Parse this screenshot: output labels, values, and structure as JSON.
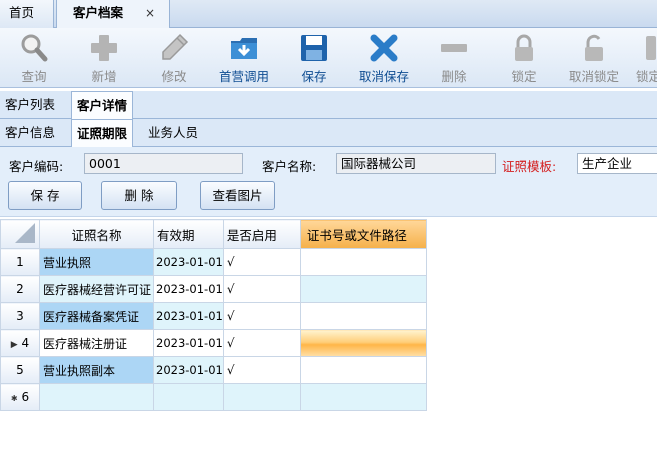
{
  "top_tabs": {
    "home": "首页",
    "active": "客户档案",
    "close": "×"
  },
  "toolbar": {
    "query": "查询",
    "add": "新增",
    "edit": "修改",
    "import": "首营调用",
    "save": "保存",
    "cancel_save": "取消保存",
    "delete": "删除",
    "lock": "锁定",
    "unlock": "取消锁定",
    "lock2": "锁定"
  },
  "tabs_row1": {
    "list": "客户列表",
    "detail": "客户详情"
  },
  "tabs_row2": {
    "info": "客户信息",
    "license": "证照期限",
    "sales": "业务人员"
  },
  "form": {
    "code_label": "客户编码:",
    "code_value": "0001",
    "name_label": "客户名称:",
    "name_value": "国际器械公司",
    "template_label": "证照模板:",
    "template_value": "生产企业",
    "save_btn": "保  存",
    "delete_btn": "删  除",
    "view_btn": "查看图片"
  },
  "grid": {
    "columns": [
      "证照名称",
      "有效期",
      "是否启用",
      "证书号或文件路径"
    ],
    "rows": [
      {
        "num": "1",
        "name": "营业执照",
        "date": "2023-01-01",
        "enabled": "√",
        "path": ""
      },
      {
        "num": "2",
        "name": "医疗器械经营许可证",
        "date": "2023-01-01",
        "enabled": "√",
        "path": ""
      },
      {
        "num": "3",
        "name": "医疗器械备案凭证",
        "date": "2023-01-01",
        "enabled": "√",
        "path": ""
      },
      {
        "num": "4",
        "name": "医疗器械注册证",
        "date": "2023-01-01",
        "enabled": "√",
        "path": ""
      },
      {
        "num": "5",
        "name": "营业执照副本",
        "date": "2023-01-01",
        "enabled": "√",
        "path": ""
      }
    ],
    "new_row": {
      "num": "6"
    },
    "current_marker": "▶",
    "new_marker": "✱"
  },
  "colors": {
    "accent": "#0f4d92",
    "required_label": "#d42020",
    "header_highlight": "#f5b04a",
    "name_cell": "#acd6f5"
  }
}
